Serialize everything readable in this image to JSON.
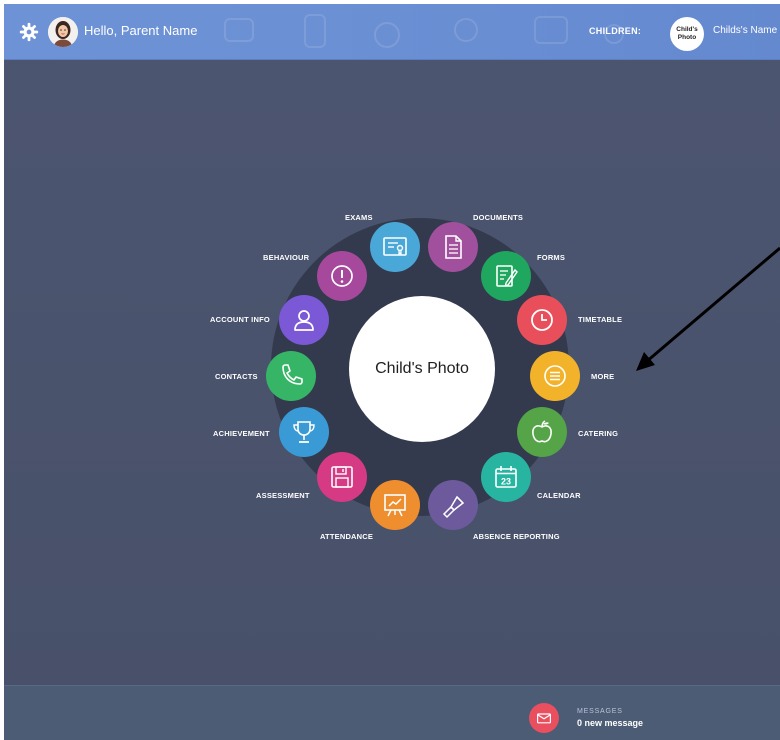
{
  "header": {
    "greeting": "Hello, Parent Name",
    "children_label": "CHILDREN:",
    "child_photo_label": "Child's Photo",
    "child_name": "Childs's Name"
  },
  "dial": {
    "center_label": "Child's Photo",
    "tiles": [
      {
        "label": "EXAMS",
        "color": "#4aa8d8",
        "icon": "certificate-icon"
      },
      {
        "label": "DOCUMENTS",
        "color": "#a0509c",
        "icon": "document-icon"
      },
      {
        "label": "FORMS",
        "color": "#1fa65f",
        "icon": "form-pen-icon"
      },
      {
        "label": "TIMETABLE",
        "color": "#e84f5a",
        "icon": "clock-icon"
      },
      {
        "label": "MORE",
        "color": "#f2b32a",
        "icon": "menu-lines-icon"
      },
      {
        "label": "CATERING",
        "color": "#55a447",
        "icon": "apple-icon"
      },
      {
        "label": "CALENDAR",
        "color": "#27b4a0",
        "icon": "calendar-icon",
        "day": "23"
      },
      {
        "label": "ABSENCE REPORTING",
        "color": "#6c5a9c",
        "icon": "torch-icon"
      },
      {
        "label": "ATTENDANCE",
        "color": "#ef8e2e",
        "icon": "presentation-icon"
      },
      {
        "label": "ASSESSMENT",
        "color": "#d63a84",
        "icon": "floppy-icon"
      },
      {
        "label": "ACHIEVEMENT",
        "color": "#3a9ad6",
        "icon": "trophy-icon"
      },
      {
        "label": "CONTACTS",
        "color": "#37b566",
        "icon": "phone-icon"
      },
      {
        "label": "ACCOUNT INFO",
        "color": "#7a58d6",
        "icon": "user-icon"
      },
      {
        "label": "BEHAVIOUR",
        "color": "#a6489c",
        "icon": "exclamation-icon"
      }
    ]
  },
  "footer": {
    "messages_title": "MESSAGES",
    "messages_count": "0 new message"
  }
}
